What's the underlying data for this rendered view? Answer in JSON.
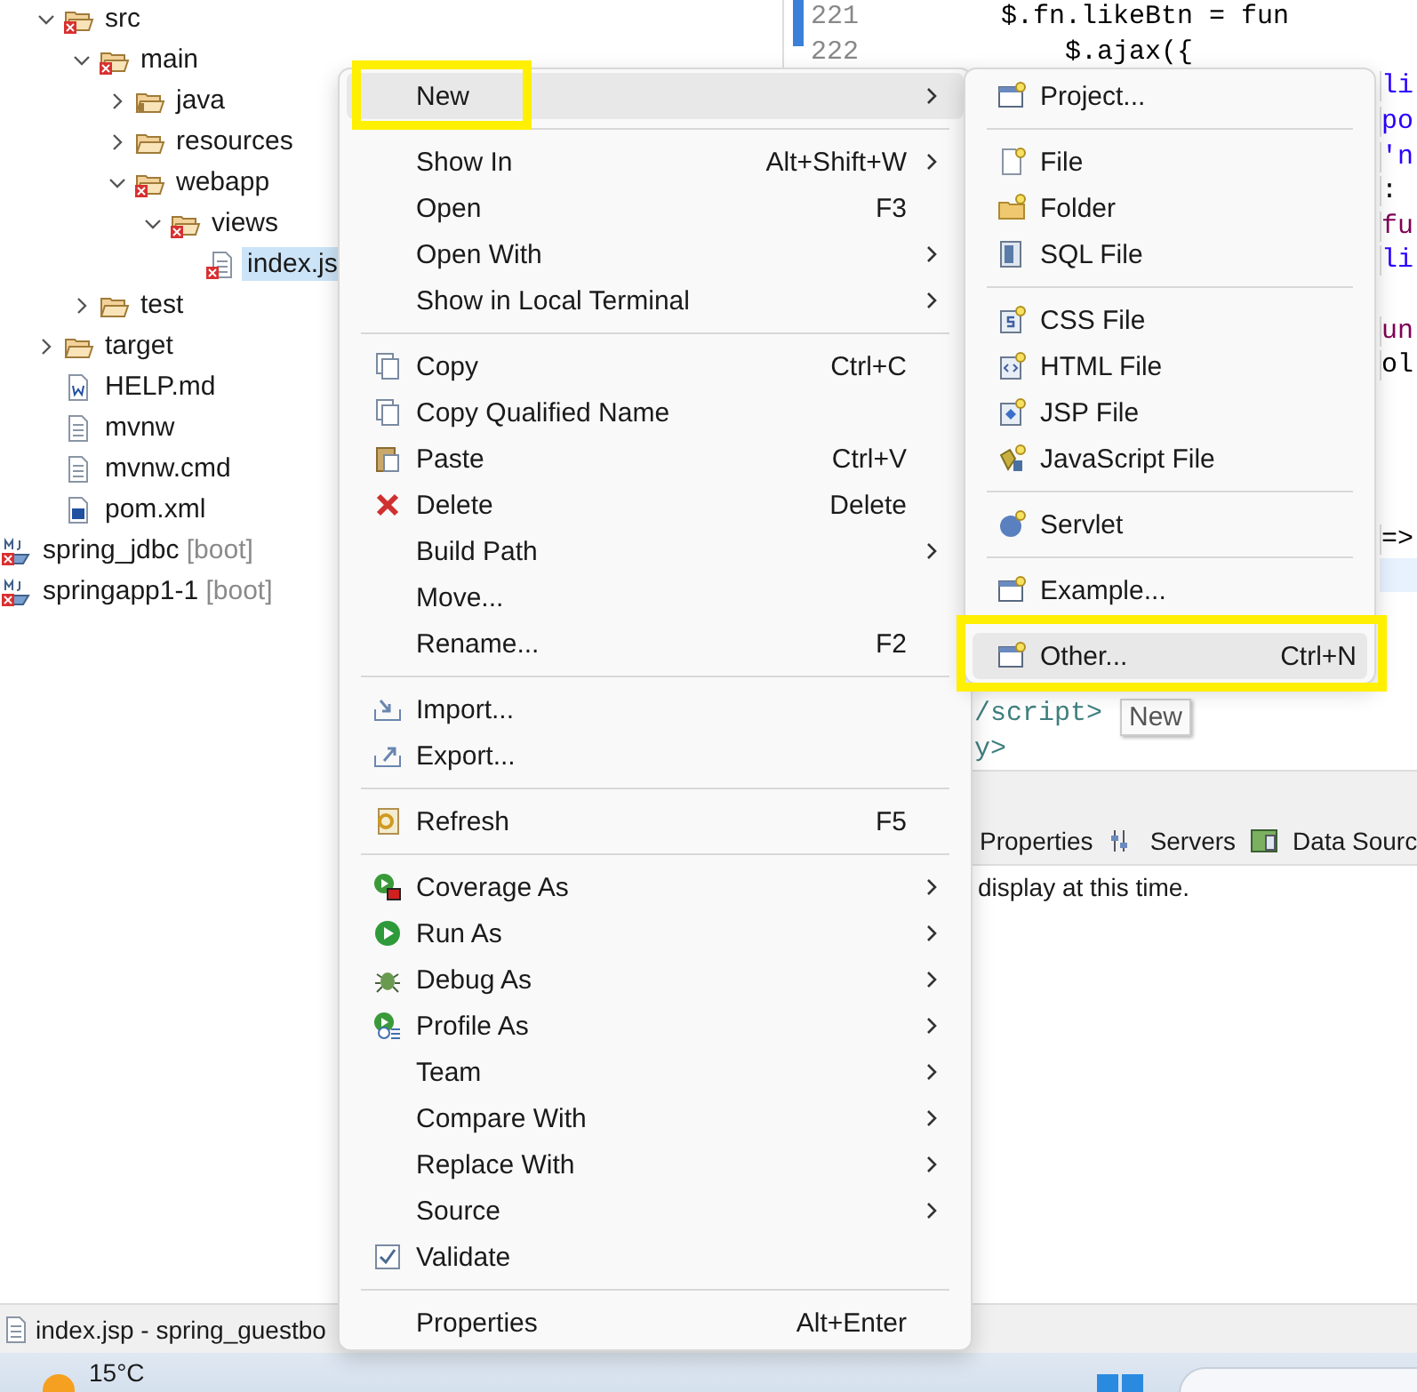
{
  "project_contents": [
    {
      "label": "src",
      "kind": "folder",
      "error": true,
      "expanded": true,
      "children": [
        {
          "label": "main",
          "kind": "folder",
          "error": true,
          "expanded": true,
          "children": [
            {
              "label": "java",
              "kind": "package-folder",
              "error": false,
              "expanded": false
            },
            {
              "label": "resources",
              "kind": "folder",
              "error": false,
              "expanded": false
            },
            {
              "label": "webapp",
              "kind": "folder",
              "error": true,
              "expanded": true,
              "children": [
                {
                  "label": "views",
                  "kind": "folder",
                  "error": true,
                  "expanded": true,
                  "children": [
                    {
                      "label": "index.js",
                      "kind": "jsp-file",
                      "error": true,
                      "selected": true
                    }
                  ]
                }
              ]
            }
          ]
        },
        {
          "label": "test",
          "kind": "folder",
          "error": false,
          "expanded": false
        }
      ]
    },
    {
      "label": "target",
      "kind": "folder",
      "error": false,
      "expanded": false
    },
    {
      "label": "HELP.md",
      "kind": "md-file",
      "error": false,
      "selected": false
    },
    {
      "label": "mvnw",
      "kind": "text-file",
      "error": false,
      "selected": false
    },
    {
      "label": "mvnw.cmd",
      "kind": "text-file",
      "error": false,
      "selected": false
    },
    {
      "label": "pom.xml",
      "kind": "xml-file",
      "error": false,
      "selected": false
    }
  ],
  "projects": [
    {
      "label": "spring_jdbc",
      "tag": "[boot]",
      "kind": "project",
      "error": true
    },
    {
      "label": "springapp1-1",
      "tag": "[boot]",
      "kind": "project",
      "error": true
    }
  ],
  "editor": {
    "lines": [
      {
        "number": "221",
        "text": "        $.fn.likeBtn = fun",
        "kind": "code",
        "color": "#000000",
        "current": false
      },
      {
        "number": "222",
        "text": "            $.ajax({",
        "kind": "code",
        "color": "#000000",
        "current": false
      },
      {
        "text": "li",
        "kind": "right",
        "color": "#2a00ff",
        "current": false
      },
      {
        "text": "po",
        "kind": "right",
        "color": "#2a00ff",
        "current": false
      },
      {
        "text": "'n",
        "kind": "right",
        "color": "#2a00ff",
        "current": false
      },
      {
        "text": ":",
        "kind": "right",
        "color": "#000000",
        "current": false
      },
      {
        "text": "fu",
        "kind": "right",
        "color": "#7f0055",
        "current": false
      },
      {
        "text": "li",
        "kind": "right",
        "color": "#2a00ff",
        "current": false
      },
      {
        "kind": "blank",
        "current": false
      },
      {
        "text": "un",
        "kind": "right",
        "color": "#7f0055",
        "current": false
      },
      {
        "text": "ol",
        "kind": "right",
        "color": "#000000",
        "current": false
      },
      {
        "kind": "blank",
        "current": false
      },
      {
        "kind": "blank",
        "current": false
      },
      {
        "kind": "blank",
        "current": false
      },
      {
        "kind": "blank",
        "current": false
      },
      {
        "text": "=>",
        "kind": "right",
        "color": "#000000",
        "current": false
      },
      {
        "kind": "blank",
        "current": true
      },
      {
        "kind": "blank",
        "current": false
      },
      {
        "kind": "blank",
        "current": false
      },
      {
        "kind": "blank",
        "current": false
      },
      {
        "text": "/script>",
        "kind": "mid",
        "color": "#3f7f7f",
        "current": false
      },
      {
        "text": "y>",
        "kind": "mid",
        "color": "#3f7f7f",
        "current": false
      }
    ]
  },
  "tooltip": {
    "text": "New"
  },
  "bottom_panel": {
    "tabs": [
      {
        "label": "Properties",
        "kind": "plain"
      },
      {
        "label": "Servers",
        "kind": "servers"
      },
      {
        "label": "Data Sourc",
        "kind": "datasource"
      }
    ],
    "message": "display at this time."
  },
  "status_bar": {
    "text": "index.jsp - spring_guestbo"
  },
  "taskbar": {
    "temperature": "15°C"
  },
  "context_menu": {
    "items": [
      {
        "kind": "plain",
        "label": "New",
        "submenu": true,
        "selected": true,
        "highlighted": true
      },
      {
        "kind": "separator"
      },
      {
        "kind": "plain",
        "label": "Show In",
        "shortcut": "Alt+Shift+W",
        "submenu": true,
        "selected": false,
        "highlighted": false
      },
      {
        "kind": "plain",
        "label": "Open",
        "shortcut": "F3",
        "submenu": false,
        "selected": false,
        "highlighted": false
      },
      {
        "kind": "plain",
        "label": "Open With",
        "submenu": true,
        "selected": false,
        "highlighted": false
      },
      {
        "kind": "plain",
        "label": "Show in Local Terminal",
        "submenu": true,
        "selected": false,
        "highlighted": false
      },
      {
        "kind": "separator"
      },
      {
        "kind": "copy",
        "label": "Copy",
        "shortcut": "Ctrl+C",
        "submenu": false,
        "selected": false,
        "highlighted": false
      },
      {
        "kind": "copy",
        "label": "Copy Qualified Name",
        "submenu": false,
        "selected": false,
        "highlighted": false
      },
      {
        "kind": "paste",
        "label": "Paste",
        "shortcut": "Ctrl+V",
        "submenu": false,
        "selected": false,
        "highlighted": false
      },
      {
        "kind": "delete",
        "label": "Delete",
        "shortcut": "Delete",
        "submenu": false,
        "selected": false,
        "highlighted": false
      },
      {
        "kind": "plain",
        "label": "Build Path",
        "submenu": true,
        "selected": false,
        "highlighted": false
      },
      {
        "kind": "plain",
        "label": "Move...",
        "submenu": false,
        "selected": false,
        "highlighted": false
      },
      {
        "kind": "plain",
        "label": "Rename...",
        "shortcut": "F2",
        "submenu": false,
        "selected": false,
        "highlighted": false
      },
      {
        "kind": "separator"
      },
      {
        "kind": "import",
        "label": "Import...",
        "submenu": false,
        "selected": false,
        "highlighted": false
      },
      {
        "kind": "export",
        "label": "Export...",
        "submenu": false,
        "selected": false,
        "highlighted": false
      },
      {
        "kind": "separator"
      },
      {
        "kind": "refresh",
        "label": "Refresh",
        "shortcut": "F5",
        "submenu": false,
        "selected": false,
        "highlighted": false
      },
      {
        "kind": "separator"
      },
      {
        "kind": "coverage",
        "label": "Coverage As",
        "submenu": true,
        "selected": false,
        "highlighted": false
      },
      {
        "kind": "run",
        "label": "Run As",
        "submenu": true,
        "selected": false,
        "highlighted": false
      },
      {
        "kind": "debug",
        "label": "Debug As",
        "submenu": true,
        "selected": false,
        "highlighted": false
      },
      {
        "kind": "profile",
        "label": "Profile As",
        "submenu": true,
        "selected": false,
        "highlighted": false
      },
      {
        "kind": "plain",
        "label": "Team",
        "submenu": true,
        "selected": false,
        "highlighted": false
      },
      {
        "kind": "plain",
        "label": "Compare With",
        "submenu": true,
        "selected": false,
        "highlighted": false
      },
      {
        "kind": "plain",
        "label": "Replace With",
        "submenu": true,
        "selected": false,
        "highlighted": false
      },
      {
        "kind": "plain",
        "label": "Source",
        "submenu": true,
        "selected": false,
        "highlighted": false
      },
      {
        "kind": "check",
        "label": "Validate",
        "submenu": false,
        "selected": false,
        "highlighted": false
      },
      {
        "kind": "separator"
      },
      {
        "kind": "plain",
        "label": "Properties",
        "shortcut": "Alt+Enter",
        "submenu": false,
        "selected": false,
        "highlighted": false
      }
    ]
  },
  "new_submenu": {
    "items": [
      {
        "kind": "wizard",
        "label": "Project...",
        "selected": false,
        "highlighted": false
      },
      {
        "kind": "separator"
      },
      {
        "kind": "file",
        "label": "File",
        "selected": false,
        "highlighted": false
      },
      {
        "kind": "folder",
        "label": "Folder",
        "selected": false,
        "highlighted": false
      },
      {
        "kind": "sql",
        "label": "SQL File",
        "selected": false,
        "highlighted": false
      },
      {
        "kind": "separator"
      },
      {
        "kind": "css",
        "label": "CSS File",
        "selected": false,
        "highlighted": false
      },
      {
        "kind": "html",
        "label": "HTML File",
        "selected": false,
        "highlighted": false
      },
      {
        "kind": "jsp",
        "label": "JSP File",
        "selected": false,
        "highlighted": false
      },
      {
        "kind": "js",
        "label": "JavaScript File",
        "selected": false,
        "highlighted": false
      },
      {
        "kind": "separator"
      },
      {
        "kind": "servlet",
        "label": "Servlet",
        "selected": false,
        "highlighted": false
      },
      {
        "kind": "separator"
      },
      {
        "kind": "wizard",
        "label": "Example...",
        "selected": false,
        "highlighted": false
      },
      {
        "kind": "separator"
      },
      {
        "kind": "wizard",
        "label": "Other...",
        "shortcut": "Ctrl+N",
        "selected": true,
        "highlighted": true
      }
    ]
  }
}
